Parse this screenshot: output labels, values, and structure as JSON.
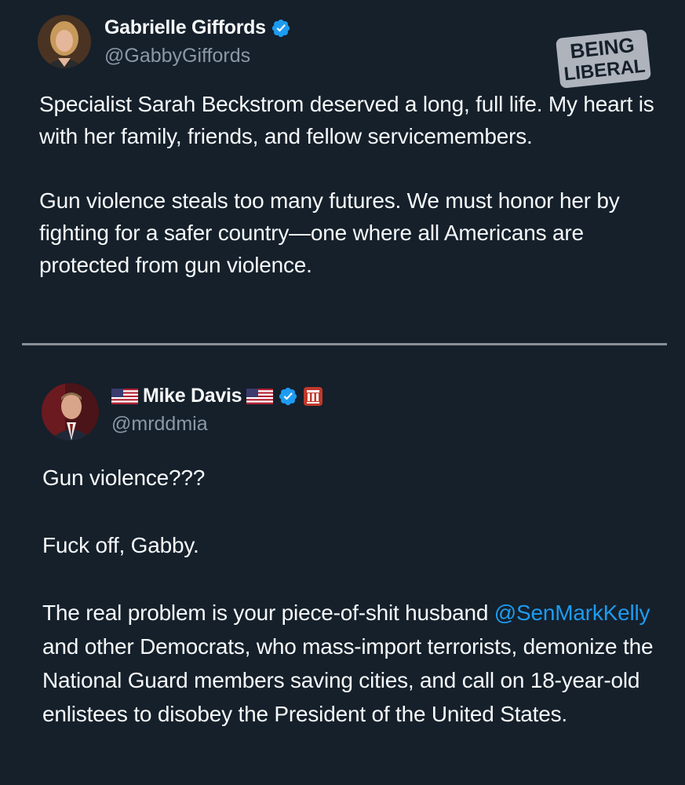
{
  "tweet1": {
    "display_name": "Gabrielle Giffords",
    "handle": "@GabbyGiffords",
    "paragraph1": "Specialist Sarah Beckstrom deserved a long, full life. My heart is with her family, friends, and fellow servicemembers.",
    "paragraph2": "Gun violence steals too many futures. We must honor her by fighting for a safer country—one where all Americans are protected from gun violence."
  },
  "watermark": {
    "line1": "BEING",
    "line2": "LIBERAL"
  },
  "tweet2": {
    "display_name": "Mike Davis",
    "handle": "@mrddmia",
    "paragraph1": "Gun violence???",
    "paragraph2": "Fuck off, Gabby.",
    "paragraph3_before": "The real problem is your piece-of-shit husband ",
    "mention": "@SenMarkKelly",
    "paragraph3_after": " and other Democrats, who mass-import terrorists, demonize the National Guard members saving cities, and call on 18-year-old enlistees to disobey the President of the United States."
  },
  "colors": {
    "background": "#15202b",
    "text": "#f7f9f9",
    "secondary": "#8b98a5",
    "link": "#1d9bf0",
    "verified": "#1d9bf0",
    "gov_badge": "#c0392b"
  },
  "icons": [
    "verified-badge-icon",
    "us-flag-icon",
    "government-badge-icon"
  ]
}
